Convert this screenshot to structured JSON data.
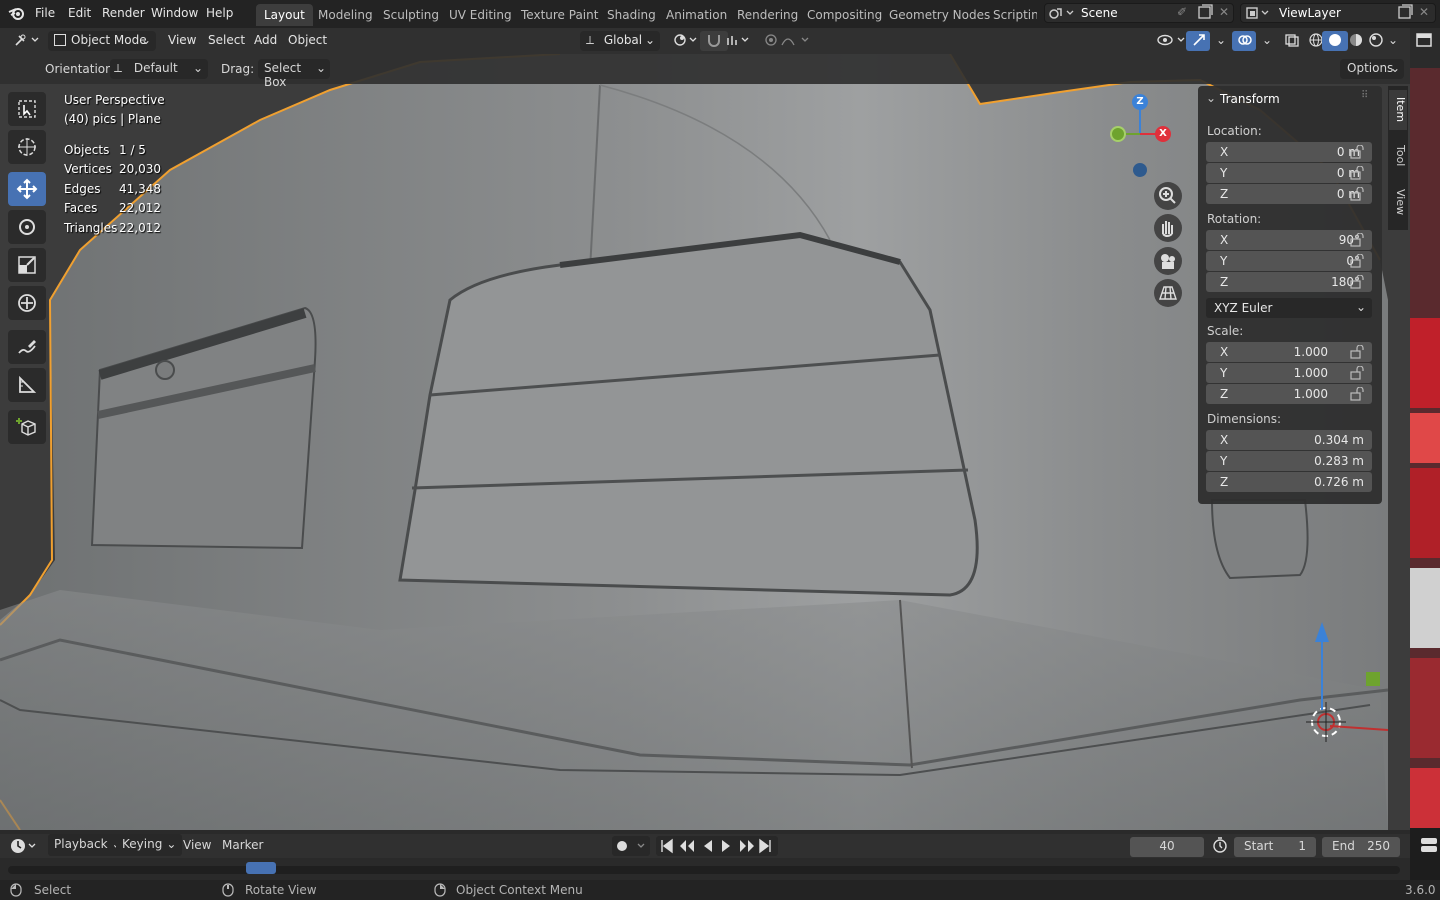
{
  "menu": {
    "items": [
      "File",
      "Edit",
      "Render",
      "Window",
      "Help"
    ],
    "workspaces": [
      "Layout",
      "Modeling",
      "Sculpting",
      "UV Editing",
      "Texture Paint",
      "Shading",
      "Animation",
      "Rendering",
      "Compositing",
      "Geometry Nodes",
      "Scripting"
    ],
    "active_workspace": "Layout",
    "scene": "Scene",
    "view_layer": "ViewLayer"
  },
  "header": {
    "mode": "Object Mode",
    "view": "View",
    "select": "Select",
    "add": "Add",
    "object": "Object",
    "transform_orientation": "Global",
    "orientation_label": "Orientation:",
    "orientation_value": "Default",
    "drag_label": "Drag:",
    "drag_value": "Select Box",
    "options": "Options"
  },
  "overlay": {
    "perspective": "User Perspective",
    "context": "(40) pics | Plane",
    "stats": [
      {
        "label": "Objects",
        "value": "1 / 5"
      },
      {
        "label": "Vertices",
        "value": "20,030"
      },
      {
        "label": "Edges",
        "value": "41,348"
      },
      {
        "label": "Faces",
        "value": "22,012"
      },
      {
        "label": "Triangles",
        "value": "22,012"
      }
    ]
  },
  "gizmo": {
    "z": "Z",
    "x": "X"
  },
  "npanel": {
    "title": "Transform",
    "tabs": [
      "Item",
      "Tool",
      "View"
    ],
    "location_label": "Location:",
    "location": [
      {
        "axis": "X",
        "value": "0 m"
      },
      {
        "axis": "Y",
        "value": "0 m"
      },
      {
        "axis": "Z",
        "value": "0 m"
      }
    ],
    "rotation_label": "Rotation:",
    "rotation": [
      {
        "axis": "X",
        "value": "90°"
      },
      {
        "axis": "Y",
        "value": "0°"
      },
      {
        "axis": "Z",
        "value": "180°"
      }
    ],
    "rotation_mode": "XYZ Euler",
    "scale_label": "Scale:",
    "scale": [
      {
        "axis": "X",
        "value": "1.000"
      },
      {
        "axis": "Y",
        "value": "1.000"
      },
      {
        "axis": "Z",
        "value": "1.000"
      }
    ],
    "dimensions_label": "Dimensions:",
    "dimensions": [
      {
        "axis": "X",
        "value": "0.304 m"
      },
      {
        "axis": "Y",
        "value": "0.283 m"
      },
      {
        "axis": "Z",
        "value": "0.726 m"
      }
    ]
  },
  "timeline": {
    "playback": "Playback",
    "keying": "Keying",
    "view": "View",
    "marker": "Marker",
    "current_frame": "40",
    "start_label": "Start",
    "start": "1",
    "end_label": "End",
    "end": "250"
  },
  "status": {
    "select": "Select",
    "rotate": "Rotate View",
    "context_menu": "Object Context Menu",
    "version": "3.6.0"
  },
  "colors": {
    "accent": "#4772b3",
    "selection_outline": "#f0a030",
    "gizmo_x": "#e0303b",
    "gizmo_y": "#6ea32e",
    "gizmo_z": "#3b82d8"
  }
}
